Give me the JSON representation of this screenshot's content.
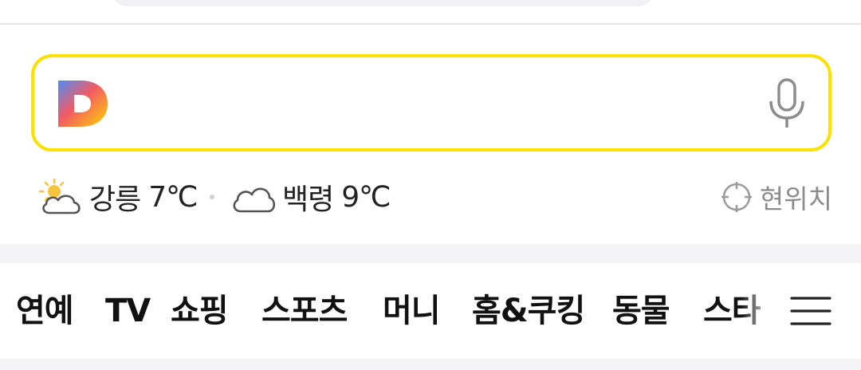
{
  "search": {
    "logo_letter": "D",
    "placeholder": ""
  },
  "weather": {
    "items": [
      {
        "city": "강릉",
        "temp": "7℃",
        "icon": "sun-cloud-icon"
      },
      {
        "city": "백령",
        "temp": "9℃",
        "icon": "cloud-icon"
      }
    ],
    "location_label": "현위치"
  },
  "nav": {
    "items": [
      "연예",
      "TV",
      "쇼핑",
      "스포츠",
      "머니",
      "홈&쿠킹",
      "동물",
      "스타"
    ]
  },
  "colors": {
    "accent": "#fae100",
    "text": "#111111",
    "muted": "#8a8a8f"
  }
}
